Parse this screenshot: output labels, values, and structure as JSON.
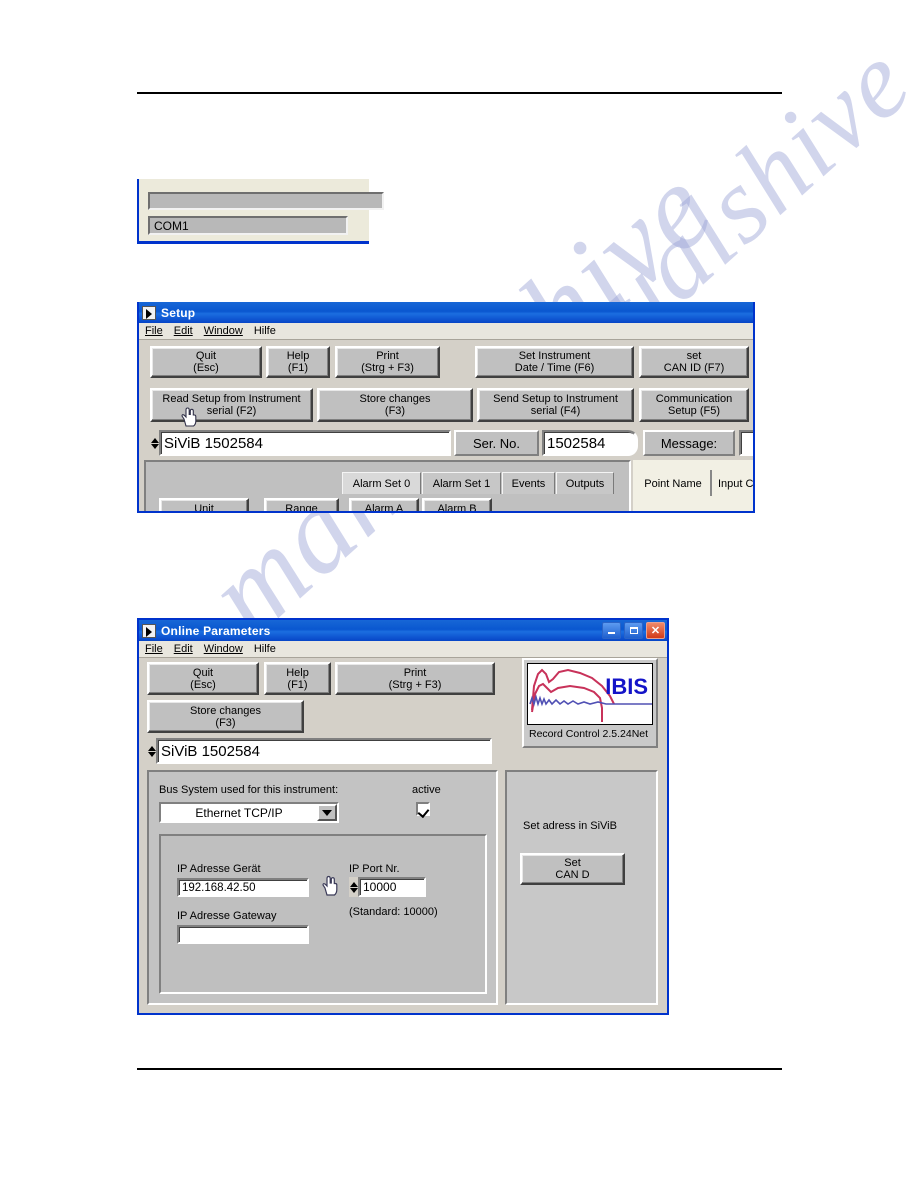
{
  "page": {
    "rules": [
      "top-rule",
      "bottom-rule"
    ],
    "watermark_text": "manualshive"
  },
  "fig_com": {
    "combo_value": "COM1"
  },
  "setup_window": {
    "title": "Setup",
    "icon": "labview-app-icon",
    "menu": [
      "File",
      "Edit",
      "Window",
      "Hilfe"
    ],
    "buttons_row1": [
      {
        "line1": "Quit",
        "line2": "(Esc)"
      },
      {
        "line1": "Help",
        "line2": "(F1)"
      },
      {
        "line1": "Print",
        "line2": "(Strg + F3)"
      },
      {
        "line1": "Set Instrument",
        "line2": "Date / Time (F6)"
      },
      {
        "line1": "set",
        "line2": "CAN ID (F7)"
      }
    ],
    "buttons_row2": [
      {
        "line1": "Read Setup from Instrument",
        "line2": "serial (F2)"
      },
      {
        "line1": "Store changes",
        "line2": "(F3)"
      },
      {
        "line1": "Send Setup to Instrument",
        "line2": "serial (F4)"
      },
      {
        "line1": "Communication",
        "line2": "Setup (F5)"
      }
    ],
    "instrument_name": "SiViB  1502584",
    "serial_label": "Ser. No.",
    "serial_value": "1502584",
    "message_label": "Message:",
    "message_value": "",
    "tabs_left": [
      "Alarm Set 0",
      "Alarm Set 1",
      "Events",
      "Outputs"
    ],
    "tabs_right": [
      "Point Name",
      "Input C"
    ],
    "subtabs": [
      "Alarm A",
      "Alarm B"
    ],
    "col_headers": [
      "Unit",
      "Range"
    ]
  },
  "online_window": {
    "title": "Online Parameters",
    "icon": "labview-app-icon",
    "menu": [
      "File",
      "Edit",
      "Window",
      "Hilfe"
    ],
    "window_buttons": [
      "minimize",
      "maximize",
      "close"
    ],
    "buttons_row1": [
      {
        "line1": "Quit",
        "line2": "(Esc)"
      },
      {
        "line1": "Help",
        "line2": "(F1)"
      },
      {
        "line1": "Print",
        "line2": "(Strg + F3)"
      }
    ],
    "buttons_row2": [
      {
        "line1": "Store changes",
        "line2": "(F3)"
      }
    ],
    "logo": {
      "word": "IBIS",
      "caption": "Record Control 2.5.24Net",
      "word_color": "#1414c8",
      "curve_color": "#c8325a",
      "wave_color": "#5050b4"
    },
    "instrument_name": "SiViB  1502584",
    "bus_group": {
      "label": "Bus System used for this instrument:",
      "combo_value": "Ethernet TCP/IP",
      "active_label": "active",
      "active_checked": true
    },
    "ip_group": {
      "device_label": "IP Adresse Gerät",
      "device_value": "192.168.42.50",
      "gateway_label": "IP Adresse Gateway",
      "gateway_value": "",
      "port_label": "IP Port Nr.",
      "port_value": "10000",
      "port_hint": "(Standard: 10000)"
    },
    "can_group": {
      "label": "Set adress in SiViB",
      "button": {
        "line1": "Set",
        "line2": "CAN D"
      }
    },
    "cursor": "hand-cursor"
  }
}
